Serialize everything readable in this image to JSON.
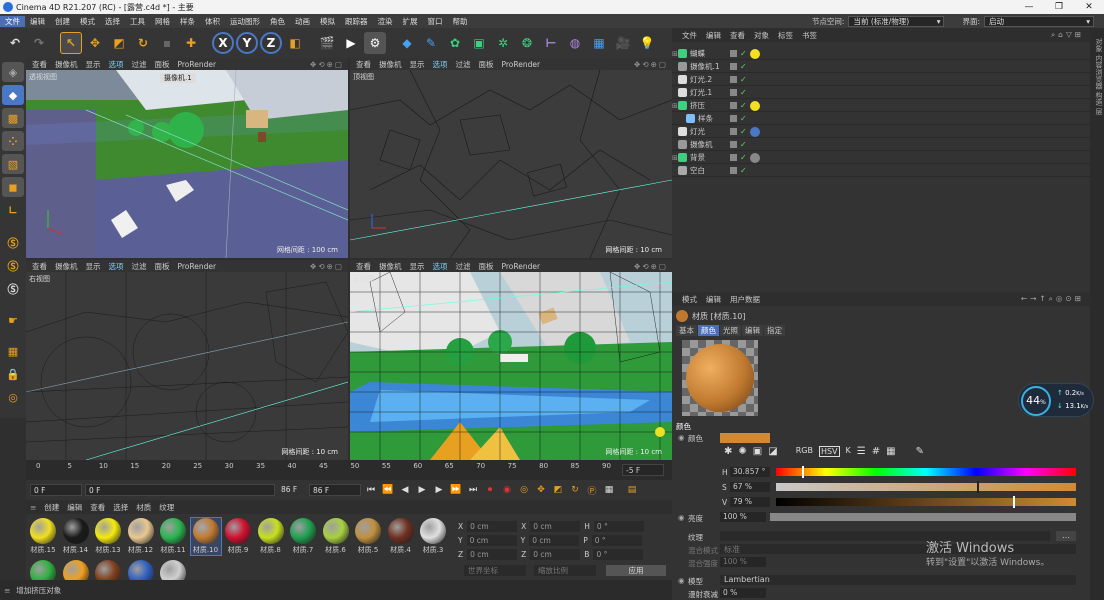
{
  "window": {
    "title": "Cinema 4D R21.207 (RC) - [露营.c4d *] - 主要",
    "min": "—",
    "restore": "❐",
    "close": "✕"
  },
  "menu": {
    "items": [
      "文件",
      "编辑",
      "创建",
      "模式",
      "选择",
      "工具",
      "网格",
      "样条",
      "体积",
      "运动图形",
      "角色",
      "动画",
      "模拟",
      "跟踪器",
      "渲染",
      "扩展",
      "窗口",
      "帮助"
    ],
    "node_space_label": "节点空间:",
    "node_space_value": "当前 (标准/物理)",
    "layout_label": "界面:",
    "layout_value": "启动"
  },
  "toolbar": {
    "x": "X",
    "y": "Y",
    "z": "Z"
  },
  "viewports": [
    {
      "menu": [
        "查看",
        "摄像机",
        "显示",
        "选项",
        "过滤",
        "面板",
        "ProRender"
      ],
      "label": "透视视图",
      "camera": "摄像机.1",
      "grid": "网格间距 : 100 cm"
    },
    {
      "menu": [
        "查看",
        "摄像机",
        "显示",
        "选项",
        "过滤",
        "面板",
        "ProRender"
      ],
      "label": "顶视图",
      "grid": "网格间距 : 10 cm"
    },
    {
      "menu": [
        "查看",
        "摄像机",
        "显示",
        "选项",
        "过滤",
        "面板",
        "ProRender"
      ],
      "label": "右视图",
      "grid": "网格间距 : 10 cm"
    },
    {
      "menu": [
        "查看",
        "摄像机",
        "显示",
        "选项",
        "过滤",
        "面板",
        "ProRender"
      ],
      "label": "正视图",
      "grid": "网格间距 : 10 cm"
    }
  ],
  "timeline": {
    "ticks": [
      "0",
      "5",
      "10",
      "15",
      "20",
      "25",
      "30",
      "35",
      "40",
      "45",
      "50",
      "55",
      "60",
      "65",
      "70",
      "75",
      "80",
      "85",
      "90"
    ],
    "end_frame": "-5 F",
    "start_field": "0 F",
    "current_field": "0 F",
    "max_field": "86 F",
    "max_field2": "86 F"
  },
  "materials": {
    "menu": [
      "创建",
      "编辑",
      "查看",
      "选择",
      "材质",
      "纹理"
    ],
    "items": [
      {
        "name": "材质.15",
        "color": "#f0e020"
      },
      {
        "name": "材质.14",
        "color": "#1a1a1a"
      },
      {
        "name": "材质.13",
        "color": "#f4ea10"
      },
      {
        "name": "材质.12",
        "color": "#e8c890"
      },
      {
        "name": "材质.11",
        "color": "#2bb550"
      },
      {
        "name": "材质.10",
        "color": "#c07a30"
      },
      {
        "name": "材质.9",
        "color": "#d01030"
      },
      {
        "name": "材质.8",
        "color": "#c8e020"
      },
      {
        "name": "材质.7",
        "color": "#20a050"
      },
      {
        "name": "材质.6",
        "color": "#a8d040"
      },
      {
        "name": "材质.5",
        "color": "#c09040"
      },
      {
        "name": "材质.4",
        "color": "#703020"
      },
      {
        "name": "材质.3",
        "color": "#e0e0e0"
      }
    ],
    "row2": [
      {
        "color": "#30b040"
      },
      {
        "color": "#f0a020"
      },
      {
        "color": "#804020"
      },
      {
        "color": "#3060c0"
      },
      {
        "color": "#d0d0d0"
      }
    ]
  },
  "coords": {
    "x_pos": "0 cm",
    "y_pos": "0 cm",
    "z_pos": "0 cm",
    "x_size": "0 cm",
    "y_size": "0 cm",
    "z_size": "0 cm",
    "h": "0 °",
    "p": "0 °",
    "b": "0 °",
    "world": "世界坐标",
    "scale": "缩放比例",
    "apply": "应用"
  },
  "status": {
    "text": "增加挤压对象"
  },
  "objects": {
    "menu": [
      "文件",
      "编辑",
      "查看",
      "对象",
      "标签",
      "书签"
    ],
    "items": [
      {
        "name": "蝴蝶",
        "icon": "#3fd07f",
        "tag": "#f4e020"
      },
      {
        "name": "摄像机.1",
        "icon": "#999"
      },
      {
        "name": "灯光.2",
        "icon": "#ddd"
      },
      {
        "name": "灯光.1",
        "icon": "#ddd"
      },
      {
        "name": "挤压",
        "icon": "#3fd07f",
        "tag": "#f4e020"
      },
      {
        "name": "样条",
        "icon": "#7fbfff"
      },
      {
        "name": "灯光",
        "icon": "#ddd",
        "tag": "#4a78c5"
      },
      {
        "name": "摄像机",
        "icon": "#999"
      },
      {
        "name": "背景",
        "icon": "#3fd07f",
        "tag": "#888"
      },
      {
        "name": "空白",
        "icon": "#aaa"
      }
    ]
  },
  "attributes": {
    "menu": [
      "模式",
      "编辑",
      "用户数据"
    ],
    "material_name": "材质 [材质.10]",
    "tabs": [
      "基本",
      "颜色",
      "光照",
      "编辑",
      "指定"
    ],
    "section": "颜色",
    "color_label": "颜色",
    "swatch": "#d08a35",
    "h_label": "H",
    "h_value": "30.857 °",
    "h_pos": 0.086,
    "s_label": "S",
    "s_value": "67 %",
    "s_pos": 0.67,
    "v_label": "V",
    "v_value": "79 %",
    "v_pos": 0.79,
    "brightness_label": "亮度",
    "brightness_value": "100 %",
    "texture_label": "纹理",
    "mix_mode_label": "混合模式",
    "mix_mode_value": "标准",
    "mix_strength_label": "混合强度",
    "mix_strength_value": "100 %",
    "model_label": "模型",
    "model_value": "Lambertian",
    "diffuse_label": "漫射衰减",
    "diffuse_value": "0 %"
  },
  "net": {
    "percent": "44",
    "unit": "%",
    "up": "0.2",
    "down": "13.1",
    "rate_unit": "K/s"
  },
  "watermark": {
    "line1": "激活 Windows",
    "line2": "转到\"设置\"以激活 Windows。"
  },
  "right_strip": "对象 内容浏览器 构造 层"
}
